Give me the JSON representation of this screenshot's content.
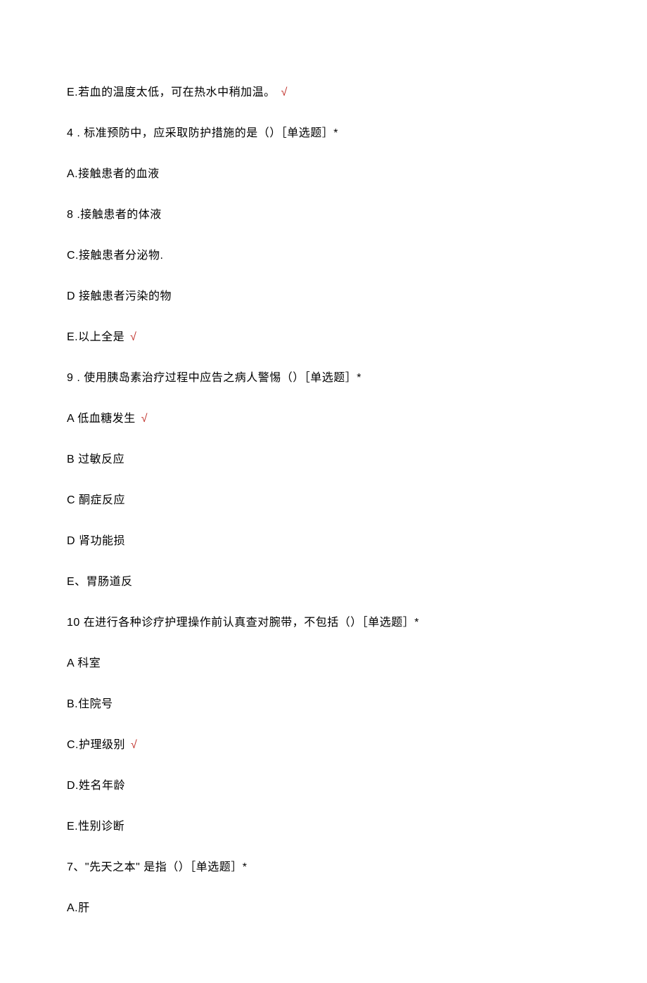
{
  "lines": [
    {
      "text": "E.若血的温度太低，可在热水中稍加温。",
      "check": true
    },
    {
      "text": "4  . 标准预防中，应采取防护措施的是（）［单选题］*",
      "check": false
    },
    {
      "text": "A.接触患者的血液",
      "check": false
    },
    {
      "text": "8  .接触患者的体液",
      "check": false
    },
    {
      "text": "C.接触患者分泌物.",
      "check": false
    },
    {
      "text": "D 接触患者污染的物",
      "check": false
    },
    {
      "text": "E.以上全是",
      "check": true
    },
    {
      "text": "9  . 使用胰岛素治疗过程中应告之病人警惕（）［单选题］*",
      "check": false
    },
    {
      "text": "A 低血糖发生",
      "check": true
    },
    {
      "text": "B 过敏反应",
      "check": false
    },
    {
      "text": "C 酮症反应",
      "check": false
    },
    {
      "text": "D 肾功能损",
      "check": false
    },
    {
      "text": "E、胃肠道反",
      "check": false
    },
    {
      "text": "10  在进行各种诊疗护理操作前认真查对腕带，不包括（）［单选题］*",
      "check": false
    },
    {
      "text": "A 科室",
      "check": false
    },
    {
      "text": "B.住院号",
      "check": false
    },
    {
      "text": "C.护理级别",
      "check": true
    },
    {
      "text": "D.姓名年龄",
      "check": false
    },
    {
      "text": "E.性别诊断",
      "check": false
    },
    {
      "text": "7、\"先天之本\" 是指（）［单选题］*",
      "check": false
    },
    {
      "text": "A.肝",
      "check": false
    }
  ],
  "checkmark": "√"
}
